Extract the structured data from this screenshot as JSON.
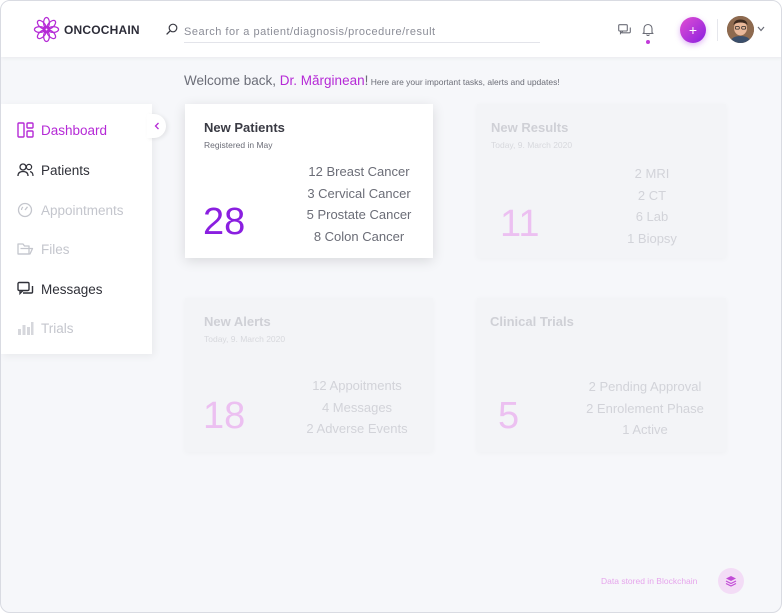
{
  "app": {
    "brand": "ONCOCHAIN"
  },
  "search": {
    "placeholder": "Search for a patient/diagnosis/procedure/result"
  },
  "header": {
    "add_label": "+"
  },
  "welcome": {
    "prefix": "Welcome back, ",
    "name": "Dr. Mărginean",
    "exclaim": "!",
    "subtitle": " Here are your important tasks, alerts and updates!"
  },
  "sidebar": {
    "items": [
      {
        "label": "Dashboard",
        "state": "active",
        "icon": "dashboard-icon"
      },
      {
        "label": "Patients",
        "state": "normal",
        "icon": "patients-icon"
      },
      {
        "label": "Appointments",
        "state": "disabled",
        "icon": "appointments-icon"
      },
      {
        "label": "Files",
        "state": "disabled",
        "icon": "files-icon"
      },
      {
        "label": "Messages",
        "state": "normal",
        "icon": "messages-icon"
      },
      {
        "label": "Trials",
        "state": "disabled",
        "icon": "trials-icon"
      }
    ]
  },
  "cards": [
    {
      "title": "New Patients",
      "subtitle": "Registered in May",
      "count": "28",
      "lines": [
        "12 Breast Cancer",
        "3 Cervical Cancer",
        "5 Prostate Cancer",
        "8 Colon Cancer"
      ]
    },
    {
      "title": "New Results",
      "subtitle": "Today, 9. March 2020",
      "count": "11",
      "lines": [
        "2 MRI",
        "2 CT",
        "6 Lab",
        "1 Biopsy"
      ]
    },
    {
      "title": "New Alerts",
      "subtitle": "Today, 9. March 2020",
      "count": "18",
      "lines": [
        "12 Appoitments",
        "4 Messages",
        "2 Adverse Events"
      ]
    },
    {
      "title": "Clinical Trials",
      "subtitle": "",
      "count": "5",
      "lines": [
        "2 Pending Approval",
        "2 Enrolement Phase",
        "1 Active"
      ]
    }
  ],
  "footer": {
    "label": "Data stored in Blockchain"
  },
  "colors": {
    "accent": "#b52ad6",
    "accent_dark": "#8a1fe0",
    "muted_pink": "#ecc0f1"
  }
}
